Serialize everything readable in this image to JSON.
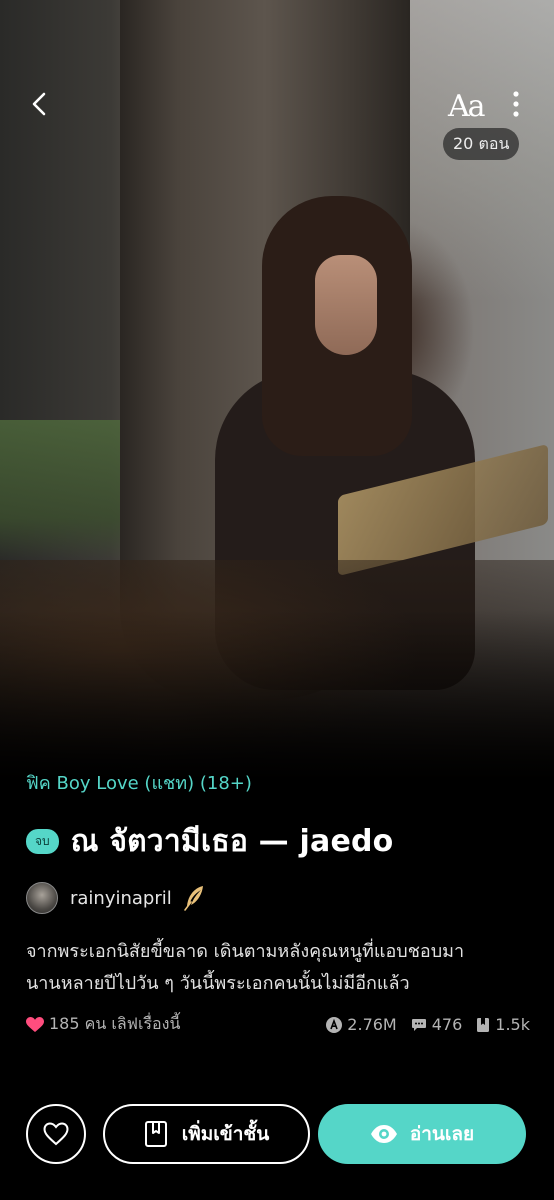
{
  "header": {
    "font_button": "Aa",
    "chapters_label": "20 ตอน"
  },
  "novel": {
    "genre": "ฟิค Boy Love (แชท) (18+)",
    "status_badge": "จบ",
    "title": "ณ จัตวามีเธอ — jaedo",
    "author": "rainyinapril",
    "description_line1": "จากพระเอกนิสัยขี้ขลาด เดินตามหลังคุณหนูที่แอบชอบมา",
    "description_line2": "นานหลายปีไปวัน ๆ วันนี้พระเอกคนนั้นไม่มีอีกแล้ว",
    "likes_text": "185 คน เลิฟเรื่องนี้",
    "views": "2.76M",
    "comments": "476",
    "bookmarks": "1.5k"
  },
  "actions": {
    "add_shelf_label": "เพิ่มเข้าชั้น",
    "read_label": "อ่านเลย"
  },
  "colors": {
    "accent": "#55d6c8",
    "heart": "#ff4d7e",
    "background": "#000000"
  },
  "icons": [
    "back-arrow-icon",
    "font-size-icon",
    "more-vertical-icon",
    "quill-icon",
    "heart-icon",
    "views-icon",
    "comment-icon",
    "bookmark-icon",
    "book-icon",
    "eye-icon"
  ]
}
